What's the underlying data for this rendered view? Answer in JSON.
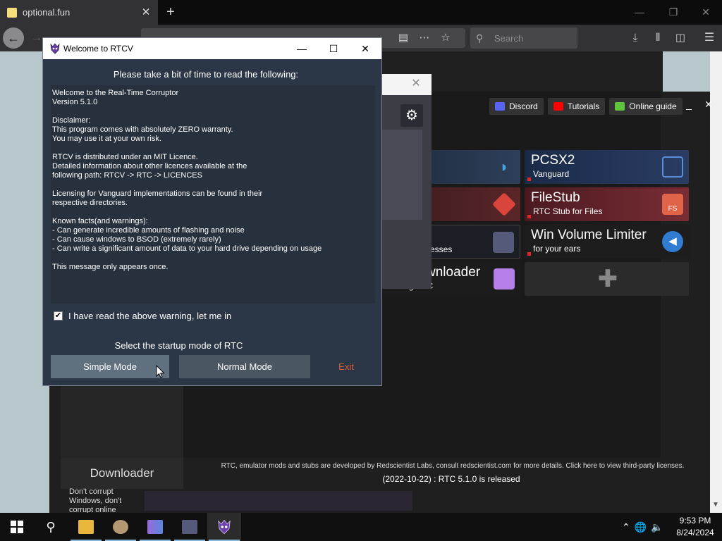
{
  "browser": {
    "tab_title": "optional.fun",
    "tab_close": "✕",
    "new_tab": "+",
    "search_placeholder": "Search",
    "window_minimize": "—",
    "window_restore": "❐",
    "window_close": "✕"
  },
  "launcher": {
    "header_buttons": [
      {
        "label": "Discord",
        "icon": "discord-icon",
        "color": "#5865f2"
      },
      {
        "label": "Tutorials",
        "icon": "youtube-icon",
        "color": "#ff0000"
      },
      {
        "label": "Online guide",
        "icon": "guide-icon",
        "color": "#5ec43e"
      }
    ],
    "minimize": "_",
    "close": "✕",
    "tiles": [
      {
        "name": "PCSX2",
        "subtitle": "Vanguard"
      },
      {
        "name": "FileStub",
        "subtitle": "RTC Stub for Files"
      },
      {
        "name": "Win Volume Limiter",
        "subtitle": "for your ears"
      }
    ],
    "partial_tiles": {
      "downloader_title": "wnloader",
      "downloader_sub": "xtending RTC",
      "processes_sub": "esses"
    },
    "inner_dialog_close": "✕",
    "gear": "⚙",
    "footer_text": "RTC, emulator mods and stubs are developed by Redscientist Labs, consult redscientist.com for more details. Click here to view third-party licenses.",
    "news": "(2022-10-22) : RTC 5.1.0 is released",
    "side_title": "Downloader",
    "side_text": "Don't corrupt Windows, don't corrupt online"
  },
  "dialog": {
    "title": "Welcome to RTCV",
    "minimize": "—",
    "maximize": "☐",
    "close": "✕",
    "heading": "Please take a bit of time to read the following:",
    "lines": [
      "Welcome to the Real-Time Corruptor",
      "Version 5.1.0",
      "",
      "Disclaimer:",
      "This program comes with absolutely ZERO warranty.",
      "You may use it at your own risk.",
      "",
      "RTCV is distributed under an MIT Licence.",
      "Detailed information about other licences available at the",
      "following path: RTCV -> RTC -> LICENCES",
      "",
      "Licensing for Vanguard implementations can be found in their",
      "respective directories.",
      "",
      "Known facts(and warnings):",
      "- Can generate incredible amounts of flashing and noise",
      "- Can cause windows to BSOD (extremely rarely)",
      "- Can write a significant amount of data to your hard drive depending on usage",
      "",
      "This message only appears once."
    ],
    "checkbox_checked": "✔",
    "checkbox_label": "I have read the above warning, let me in",
    "startup_label": "Select the startup mode of RTC",
    "btn_simple": "Simple Mode",
    "btn_normal": "Normal Mode",
    "btn_exit": "Exit"
  },
  "taskbar": {
    "search": "⚲",
    "tray_chevron": "⌃",
    "tray_network": "🌐",
    "tray_volume": "🔈",
    "time": "9:53 PM",
    "date": "8/24/2024"
  }
}
